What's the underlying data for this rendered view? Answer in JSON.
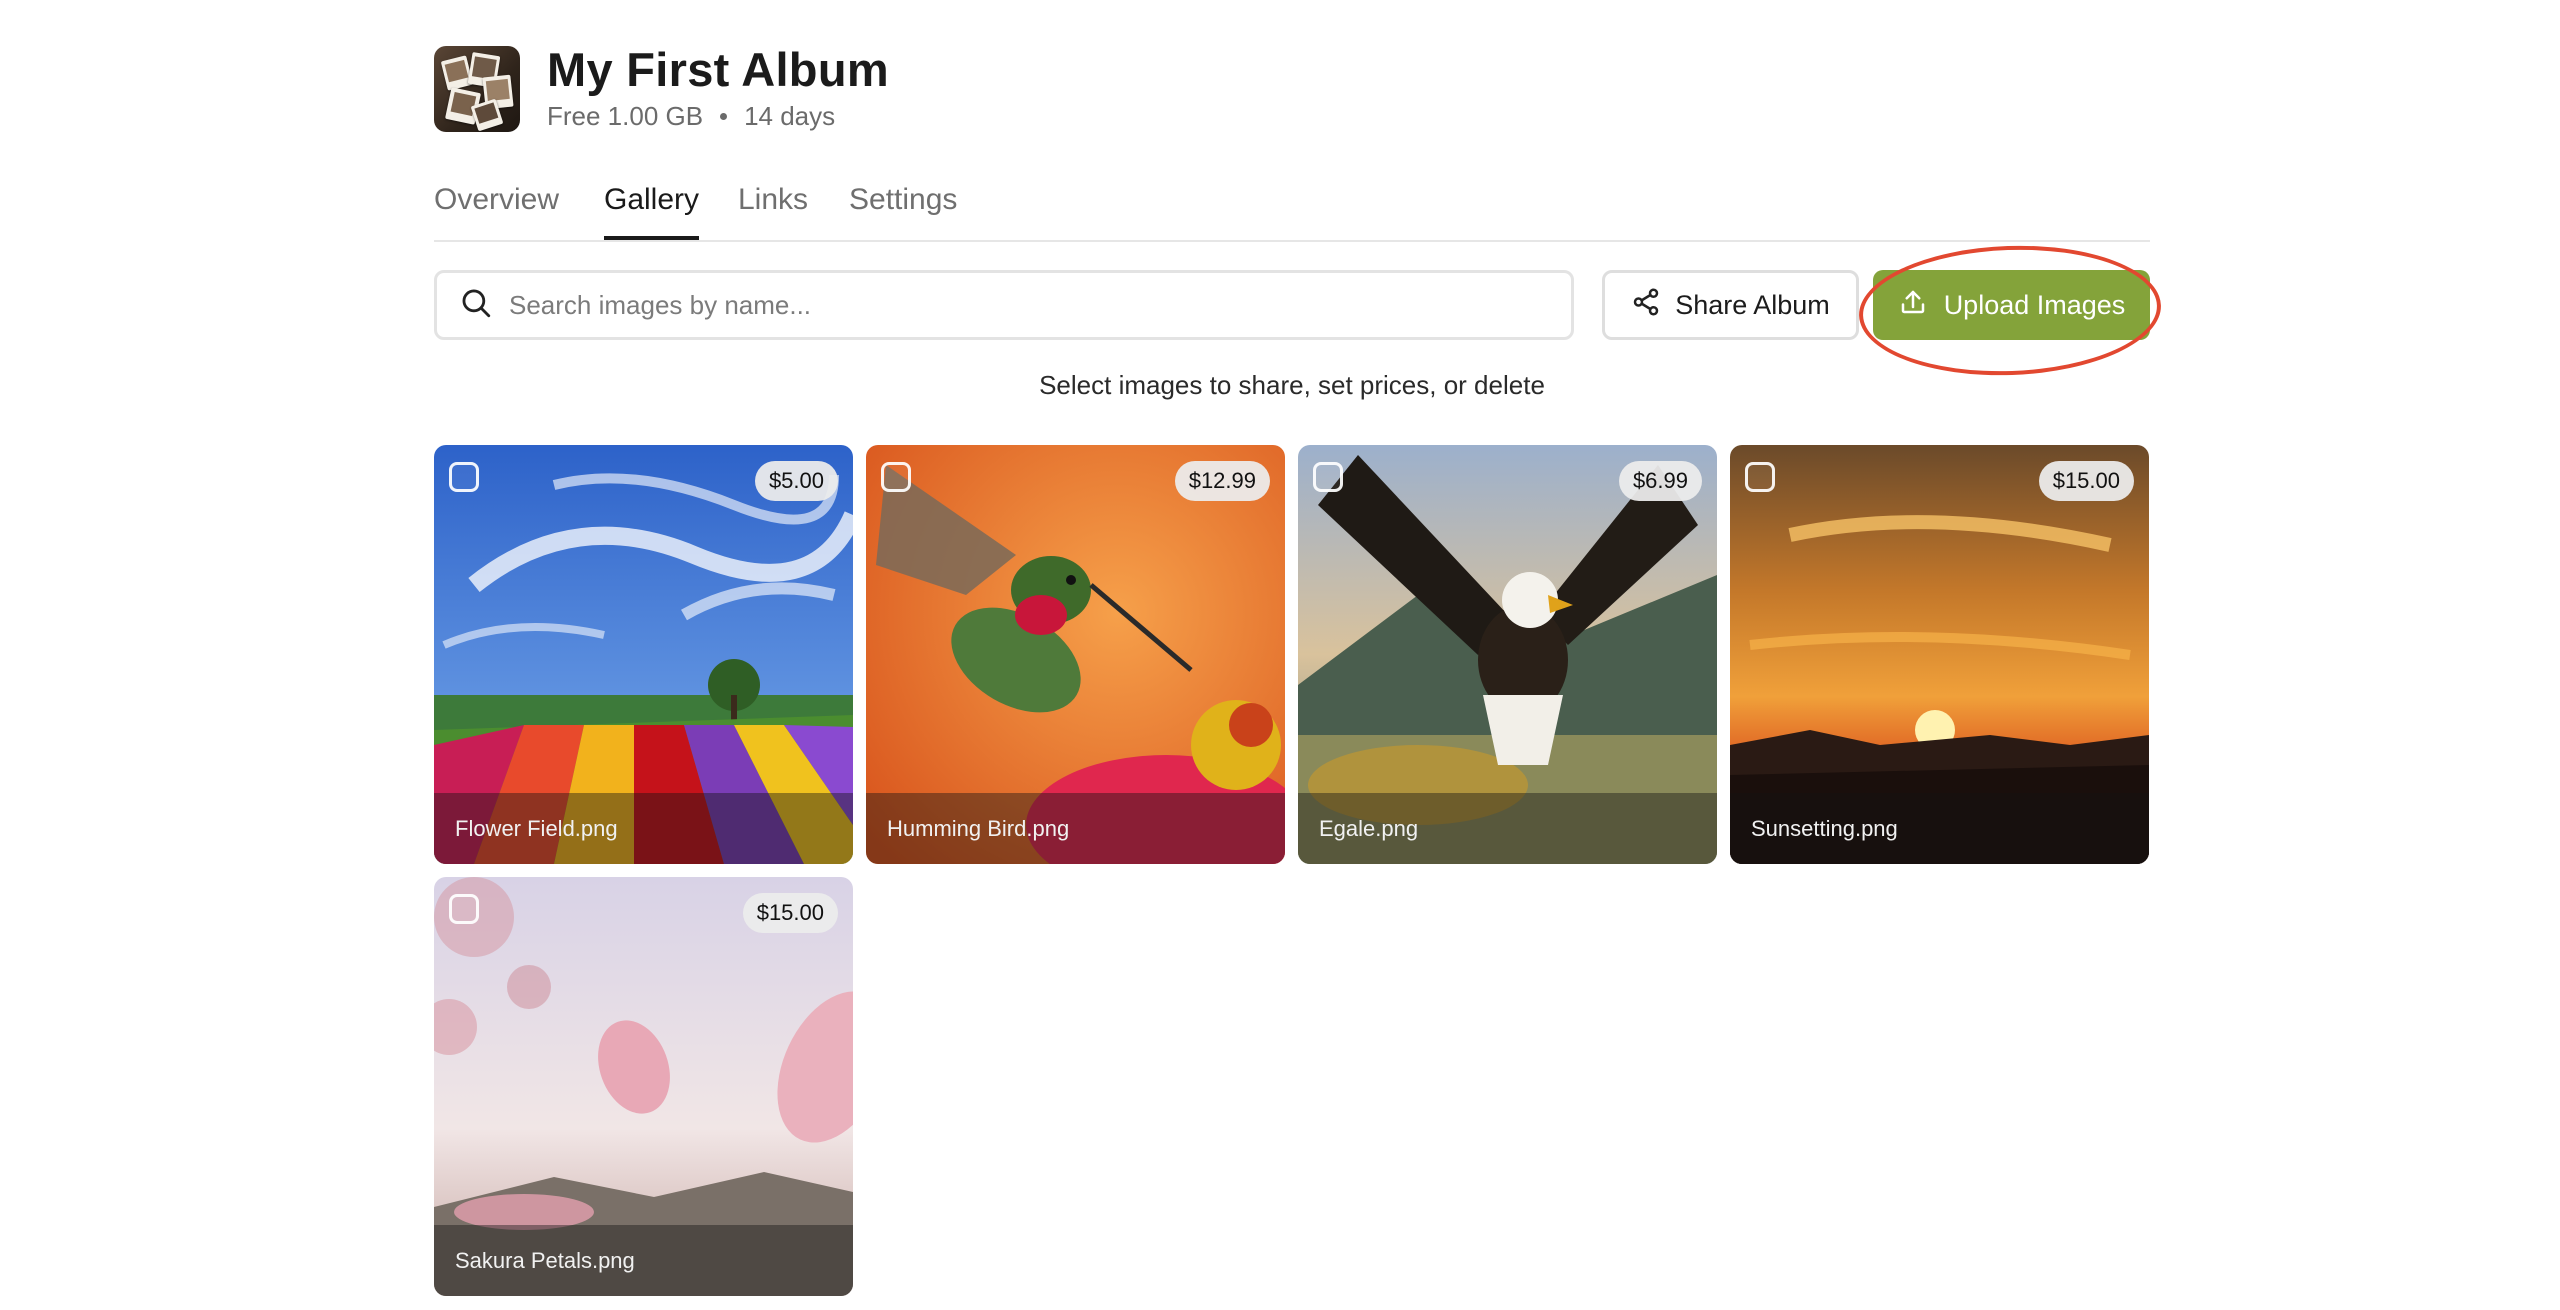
{
  "album": {
    "title": "My First Album",
    "plan": "Free 1.00 GB",
    "duration": "14 days",
    "thumbnail_icon": "photo-stack-icon"
  },
  "tabs": [
    {
      "label": "Overview",
      "active": false
    },
    {
      "label": "Gallery",
      "active": true
    },
    {
      "label": "Links",
      "active": false
    },
    {
      "label": "Settings",
      "active": false
    }
  ],
  "search": {
    "placeholder": "Search images by name...",
    "value": "",
    "icon": "search-icon"
  },
  "actions": {
    "share_label": "Share Album",
    "share_icon": "share-icon",
    "upload_label": "Upload Images",
    "upload_icon": "upload-icon"
  },
  "hint": "Select images to share, set prices, or delete",
  "colors": {
    "accent": "#84a33a",
    "annotation": "#e24830"
  },
  "images": [
    {
      "name": "Flower Field.png",
      "price": "$5.00",
      "selected": false
    },
    {
      "name": "Humming Bird.png",
      "price": "$12.99",
      "selected": false
    },
    {
      "name": "Egale.png",
      "price": "$6.99",
      "selected": false
    },
    {
      "name": "Sunsetting.png",
      "price": "$15.00",
      "selected": false
    },
    {
      "name": "Sakura Petals.png",
      "price": "$15.00",
      "selected": false
    }
  ]
}
